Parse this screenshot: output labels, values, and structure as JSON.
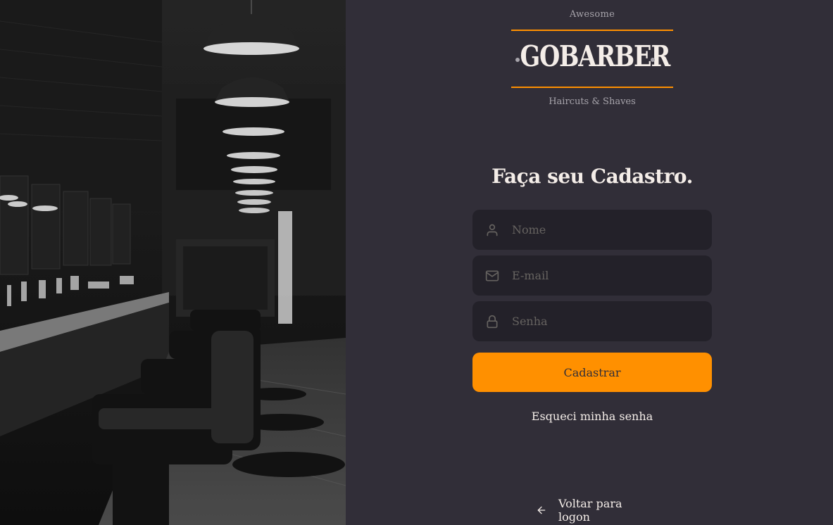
{
  "logo": {
    "top_text": "Awesome",
    "brand": "GOBARBER",
    "tagline": "Haircuts & Shaves"
  },
  "form": {
    "title": "Faça seu Cadastro.",
    "name_placeholder": "Nome",
    "email_placeholder": "E-mail",
    "password_placeholder": "Senha",
    "submit_label": "Cadastrar",
    "forgot_label": "Esqueci minha senha"
  },
  "footer": {
    "back_label": "Voltar para logon"
  },
  "icons": {
    "name": "user-icon",
    "email": "mail-icon",
    "password": "lock-icon",
    "back": "arrow-left-icon"
  },
  "colors": {
    "background": "#312e38",
    "input_background": "#232129",
    "accent": "#ff9000",
    "text": "#f4ede8",
    "muted": "#666360"
  }
}
